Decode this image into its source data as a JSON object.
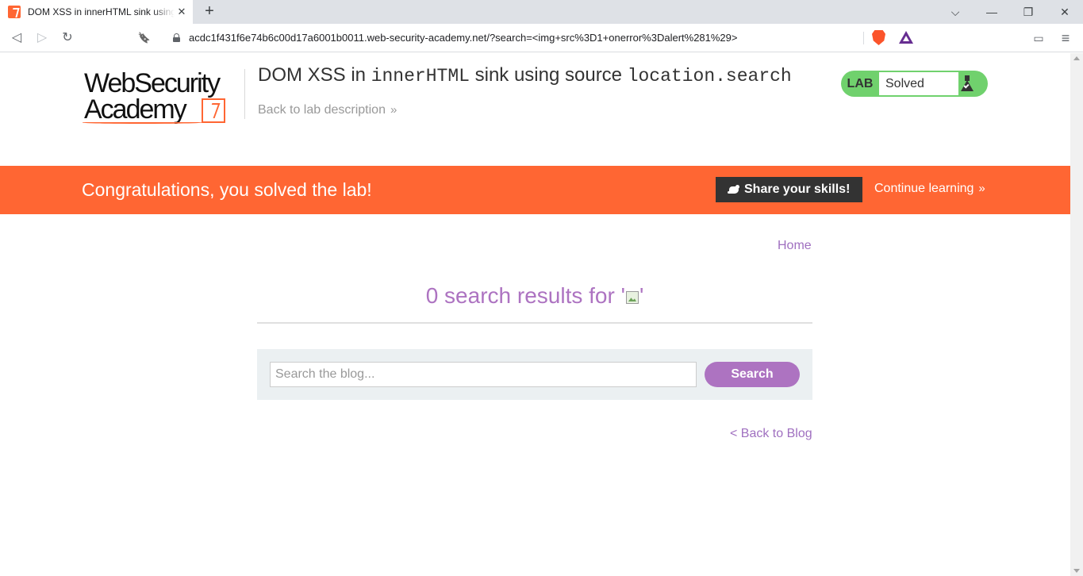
{
  "browser": {
    "tab_title": "DOM XSS in innerHTML sink using source location.search",
    "tab_close_glyph": "✕",
    "new_tab_glyph": "+",
    "window_controls": {
      "tab_search": "⌵",
      "minimize": "—",
      "restore": "❐",
      "close": "✕"
    },
    "toolbar_glyphs": {
      "back": "◁",
      "forward": "▷",
      "reload": "↻",
      "bookmark": "🔖",
      "wallet": "▭",
      "menu": "≡"
    },
    "url": "acdc1f431f6e74b6c00d17a6001b0011.web-security-academy.net/?search=<img+src%3D1+onerror%3Dalert%281%29>"
  },
  "header": {
    "logo_line1": "WebSecurity",
    "logo_line2": "Academy",
    "lab_title_prefix": "DOM XSS in ",
    "lab_title_code1": "innerHTML",
    "lab_title_middle": " sink using source ",
    "lab_title_code2": "location.search",
    "back_to_description": "Back to lab description",
    "chevron": "»",
    "lab_tag": "LAB",
    "lab_status": "Solved"
  },
  "banner": {
    "message": "Congratulations, you solved the lab!",
    "share_label": "Share your skills!",
    "continue_label": "Continue learning",
    "chevron": "»"
  },
  "main": {
    "home_link": "Home",
    "results_prefix": "0 search results for '",
    "results_suffix": "'",
    "search_placeholder": "Search the blog...",
    "search_button": "Search",
    "back_to_blog": "< Back to Blog"
  },
  "colors": {
    "brand_orange": "#ff6633",
    "accent_purple": "#ad73c1",
    "lab_solved_green": "#70d16d"
  }
}
